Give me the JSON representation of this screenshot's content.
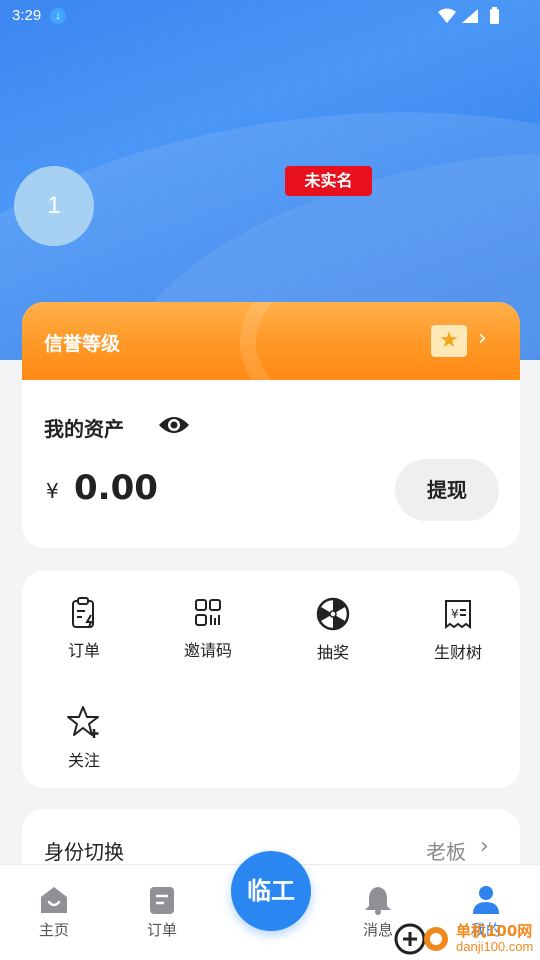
{
  "status_bar": {
    "time": "3:29"
  },
  "profile": {
    "avatar_text": "1",
    "verify_badge": "未实名"
  },
  "credit": {
    "label": "信誉等级"
  },
  "assets": {
    "title": "我的资产",
    "currency": "¥",
    "amount": "0.00",
    "withdraw_label": "提现"
  },
  "features": [
    {
      "label": "订单",
      "icon": "order-clipboard-icon"
    },
    {
      "label": "邀请码",
      "icon": "qr-code-icon"
    },
    {
      "label": "抽奖",
      "icon": "lottery-wheel-icon"
    },
    {
      "label": "生财树",
      "icon": "money-receipt-icon"
    },
    {
      "label": "关注",
      "icon": "star-plus-icon"
    }
  ],
  "role_switch": {
    "label": "身份切换",
    "value": "老板"
  },
  "tabbar": {
    "tabs": [
      {
        "label": "主页",
        "icon": "home-icon"
      },
      {
        "label": "订单",
        "icon": "order-icon"
      },
      {
        "label": "消息",
        "icon": "bell-icon"
      },
      {
        "label": "我的",
        "icon": "user-icon"
      }
    ],
    "center_label": "临工",
    "active_tab": "我的"
  },
  "watermark": {
    "site": "单机100网",
    "url": "danji100.com"
  },
  "colors": {
    "accent": "#2a86f0",
    "orange": "#ff9826",
    "badge_red": "#e8101d"
  }
}
